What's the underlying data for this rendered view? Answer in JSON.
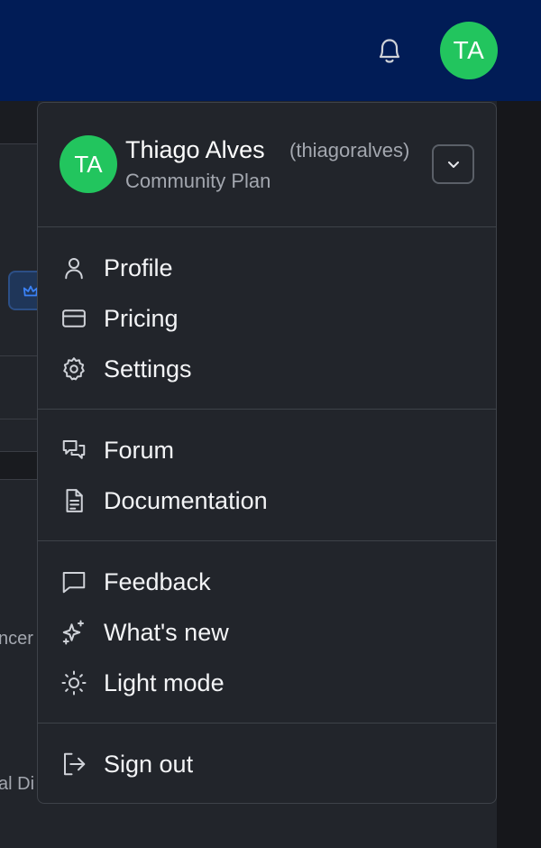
{
  "topbar": {
    "avatar_initials": "TA",
    "bell_icon": "bell-icon",
    "bar_color": "#011c56",
    "avatar_color": "#22c55e"
  },
  "background": {
    "crown_icon": "crown-icon",
    "snippet_1": "ncer",
    "snippet_2": "al Di"
  },
  "user_menu": {
    "avatar_initials": "TA",
    "name": "Thiago Alves",
    "handle": "(thiagoralves)",
    "plan": "Community Plan",
    "expand_icon": "chevron-down-icon",
    "sections": [
      [
        {
          "label": "Profile",
          "icon": "user-icon"
        },
        {
          "label": "Pricing",
          "icon": "credit-card-icon"
        },
        {
          "label": "Settings",
          "icon": "gear-icon"
        }
      ],
      [
        {
          "label": "Forum",
          "icon": "chat-bubbles-icon"
        },
        {
          "label": "Documentation",
          "icon": "document-icon"
        }
      ],
      [
        {
          "label": "Feedback",
          "icon": "message-square-icon"
        },
        {
          "label": "What's new",
          "icon": "sparkles-icon"
        },
        {
          "label": "Light mode",
          "icon": "sun-icon"
        }
      ],
      [
        {
          "label": "Sign out",
          "icon": "sign-out-icon"
        }
      ]
    ]
  }
}
